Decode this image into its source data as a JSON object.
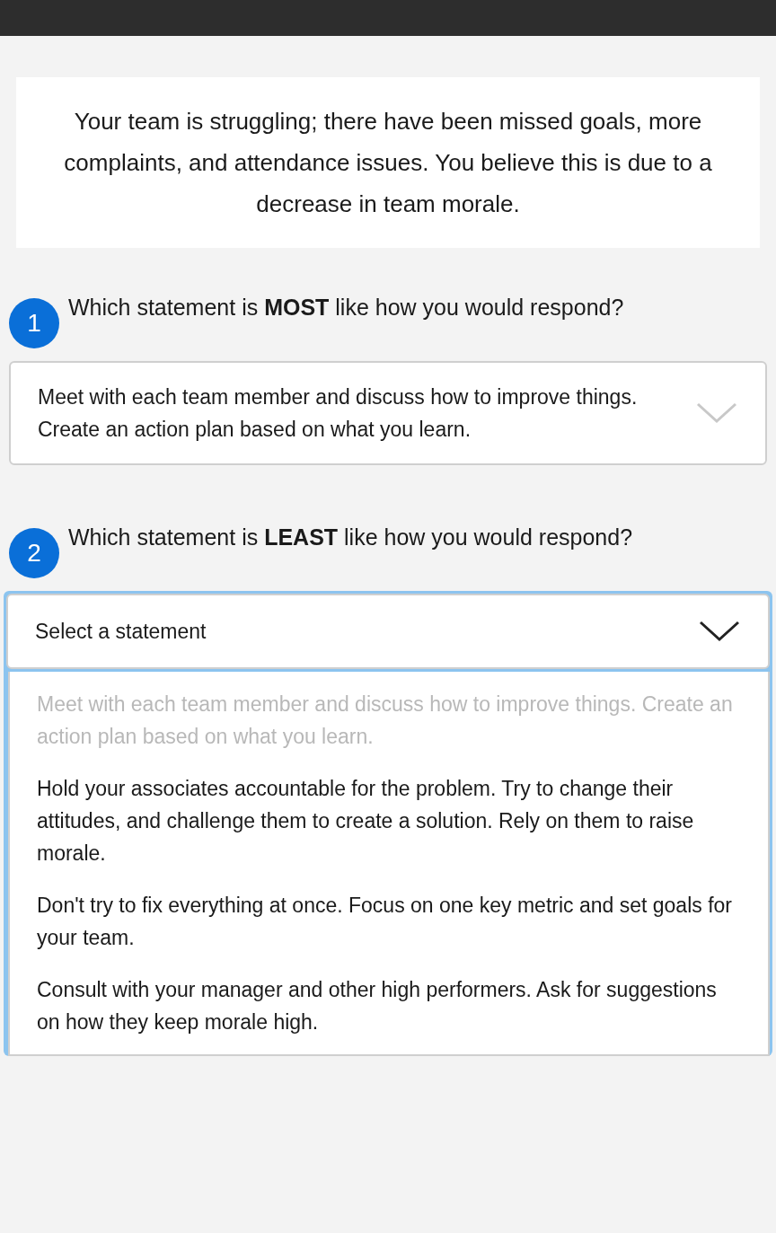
{
  "scenario": "Your team is struggling; there have been missed goals, more complaints, and attendance issues. You believe this is due to a decrease in team morale.",
  "questions": [
    {
      "number": "1",
      "prompt": "Which statement is **MOST** like how you would respond?",
      "dropdown": {
        "value": "Meet with each team member and discuss how to improve things. Create an action plan based on what you learn.",
        "expanded": false,
        "focused": false
      }
    },
    {
      "number": "2",
      "prompt": "Which statement is **LEAST** like how you would respond?",
      "dropdown": {
        "placeholder": "Select a statement",
        "expanded": true,
        "focused": true,
        "options": [
          {
            "label": "Meet with each team member and discuss how to improve things. Create an action plan based on what you learn.",
            "disabled": true
          },
          {
            "label": "Hold your associates accountable for the problem. Try to change their attitudes, and challenge them to create a solution. Rely on them to raise morale.",
            "disabled": false
          },
          {
            "label": "Don't try to fix everything at once. Focus on one key metric and set goals for your team.",
            "disabled": false
          },
          {
            "label": "Consult with your manager and other high performers. Ask for suggestions on how they keep morale high.",
            "disabled": false
          }
        ]
      }
    }
  ]
}
